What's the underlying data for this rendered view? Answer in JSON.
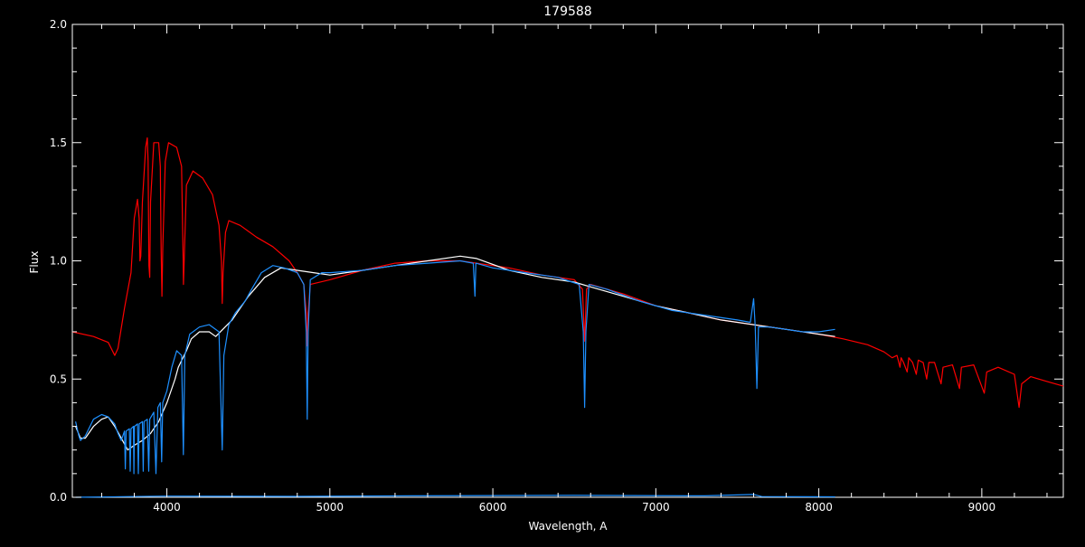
{
  "chart_data": {
    "type": "line",
    "title": "179588",
    "xlabel": "Wavelength, A",
    "ylabel": "Flux",
    "xlim": [
      3420,
      9500
    ],
    "ylim": [
      0.0,
      2.0
    ],
    "x_ticks": [
      {
        "value": 4000,
        "label": "4000"
      },
      {
        "value": 5000,
        "label": "5000"
      },
      {
        "value": 6000,
        "label": "6000"
      },
      {
        "value": 7000,
        "label": "7000"
      },
      {
        "value": 8000,
        "label": "8000"
      },
      {
        "value": 9000,
        "label": "9000"
      }
    ],
    "y_ticks": [
      {
        "value": 0.0,
        "label": "0.0"
      },
      {
        "value": 0.5,
        "label": "0.5"
      },
      {
        "value": 1.0,
        "label": "1.0"
      },
      {
        "value": 1.5,
        "label": "1.5"
      },
      {
        "value": 2.0,
        "label": "2.0"
      }
    ],
    "grid": false,
    "background": "#000000",
    "axis_color": "#ffffff",
    "series": [
      {
        "color": "#ff0000",
        "points": [
          [
            3420,
            0.7
          ],
          [
            3550,
            0.68
          ],
          [
            3640,
            0.655
          ],
          [
            3680,
            0.6
          ],
          [
            3700,
            0.63
          ],
          [
            3740,
            0.8
          ],
          [
            3780,
            0.95
          ],
          [
            3800,
            1.18
          ],
          [
            3820,
            1.26
          ],
          [
            3830,
            1.18
          ],
          [
            3835,
            1.0
          ],
          [
            3840,
            1.02
          ],
          [
            3850,
            1.25
          ],
          [
            3870,
            1.48
          ],
          [
            3880,
            1.52
          ],
          [
            3885,
            1.42
          ],
          [
            3890,
            0.98
          ],
          [
            3895,
            0.93
          ],
          [
            3900,
            1.25
          ],
          [
            3920,
            1.5
          ],
          [
            3950,
            1.5
          ],
          [
            3960,
            1.4
          ],
          [
            3965,
            1.05
          ],
          [
            3970,
            0.85
          ],
          [
            3975,
            1.05
          ],
          [
            3990,
            1.42
          ],
          [
            4010,
            1.5
          ],
          [
            4060,
            1.48
          ],
          [
            4090,
            1.4
          ],
          [
            4100,
            1.0
          ],
          [
            4102,
            0.9
          ],
          [
            4106,
            1.0
          ],
          [
            4120,
            1.32
          ],
          [
            4160,
            1.38
          ],
          [
            4220,
            1.35
          ],
          [
            4280,
            1.28
          ],
          [
            4320,
            1.15
          ],
          [
            4335,
            1.0
          ],
          [
            4340,
            0.82
          ],
          [
            4345,
            0.95
          ],
          [
            4360,
            1.12
          ],
          [
            4380,
            1.17
          ],
          [
            4450,
            1.15
          ],
          [
            4550,
            1.1
          ],
          [
            4650,
            1.06
          ],
          [
            4750,
            1.0
          ],
          [
            4800,
            0.95
          ],
          [
            4840,
            0.9
          ],
          [
            4855,
            0.78
          ],
          [
            4861,
            0.64
          ],
          [
            4867,
            0.78
          ],
          [
            4880,
            0.9
          ],
          [
            5000,
            0.92
          ],
          [
            5200,
            0.96
          ],
          [
            5400,
            0.99
          ],
          [
            5600,
            1.0
          ],
          [
            5800,
            1.0
          ],
          [
            5900,
            0.99
          ],
          [
            6100,
            0.97
          ],
          [
            6300,
            0.94
          ],
          [
            6500,
            0.92
          ],
          [
            6550,
            0.88
          ],
          [
            6563,
            0.66
          ],
          [
            6575,
            0.88
          ],
          [
            6600,
            0.9
          ],
          [
            6800,
            0.86
          ],
          [
            7000,
            0.81
          ],
          [
            7200,
            0.78
          ],
          [
            7400,
            0.75
          ],
          [
            7600,
            0.73
          ],
          [
            7800,
            0.71
          ],
          [
            8000,
            0.69
          ],
          [
            8150,
            0.67
          ],
          [
            8300,
            0.645
          ],
          [
            8400,
            0.615
          ],
          [
            8450,
            0.59
          ],
          [
            8480,
            0.6
          ],
          [
            8498,
            0.55
          ],
          [
            8505,
            0.59
          ],
          [
            8520,
            0.57
          ],
          [
            8542,
            0.53
          ],
          [
            8552,
            0.59
          ],
          [
            8575,
            0.57
          ],
          [
            8598,
            0.52
          ],
          [
            8610,
            0.58
          ],
          [
            8640,
            0.57
          ],
          [
            8662,
            0.5
          ],
          [
            8675,
            0.57
          ],
          [
            8710,
            0.57
          ],
          [
            8750,
            0.48
          ],
          [
            8762,
            0.55
          ],
          [
            8820,
            0.56
          ],
          [
            8863,
            0.46
          ],
          [
            8875,
            0.55
          ],
          [
            8950,
            0.56
          ],
          [
            9015,
            0.44
          ],
          [
            9030,
            0.53
          ],
          [
            9100,
            0.55
          ],
          [
            9200,
            0.52
          ],
          [
            9229,
            0.38
          ],
          [
            9245,
            0.48
          ],
          [
            9300,
            0.51
          ],
          [
            9400,
            0.49
          ],
          [
            9500,
            0.47
          ]
        ]
      },
      {
        "color": "#ffffff",
        "points": [
          [
            3440,
            0.3
          ],
          [
            3470,
            0.25
          ],
          [
            3500,
            0.25
          ],
          [
            3550,
            0.3
          ],
          [
            3600,
            0.33
          ],
          [
            3640,
            0.34
          ],
          [
            3680,
            0.3
          ],
          [
            3720,
            0.25
          ],
          [
            3760,
            0.2
          ],
          [
            3800,
            0.22
          ],
          [
            3850,
            0.24
          ],
          [
            3900,
            0.27
          ],
          [
            3950,
            0.32
          ],
          [
            4000,
            0.4
          ],
          [
            4050,
            0.5
          ],
          [
            4070,
            0.55
          ],
          [
            4120,
            0.62
          ],
          [
            4150,
            0.67
          ],
          [
            4200,
            0.7
          ],
          [
            4260,
            0.7
          ],
          [
            4300,
            0.68
          ],
          [
            4400,
            0.75
          ],
          [
            4500,
            0.85
          ],
          [
            4600,
            0.93
          ],
          [
            4700,
            0.97
          ],
          [
            4800,
            0.96
          ],
          [
            4900,
            0.95
          ],
          [
            5000,
            0.94
          ],
          [
            5200,
            0.96
          ],
          [
            5400,
            0.98
          ],
          [
            5600,
            1.0
          ],
          [
            5800,
            1.02
          ],
          [
            5900,
            1.01
          ],
          [
            6100,
            0.96
          ],
          [
            6300,
            0.93
          ],
          [
            6500,
            0.91
          ],
          [
            6600,
            0.89
          ],
          [
            6800,
            0.85
          ],
          [
            7000,
            0.81
          ],
          [
            7200,
            0.78
          ],
          [
            7400,
            0.75
          ],
          [
            7600,
            0.73
          ],
          [
            7800,
            0.71
          ],
          [
            8000,
            0.69
          ],
          [
            8100,
            0.68
          ]
        ]
      },
      {
        "color": "#1e90ff",
        "points": [
          [
            3440,
            0.32
          ],
          [
            3460,
            0.26
          ],
          [
            3470,
            0.24
          ],
          [
            3500,
            0.26
          ],
          [
            3550,
            0.33
          ],
          [
            3600,
            0.35
          ],
          [
            3640,
            0.34
          ],
          [
            3680,
            0.31
          ],
          [
            3700,
            0.27
          ],
          [
            3720,
            0.24
          ],
          [
            3740,
            0.28
          ],
          [
            3745,
            0.12
          ],
          [
            3750,
            0.28
          ],
          [
            3770,
            0.29
          ],
          [
            3775,
            0.11
          ],
          [
            3780,
            0.29
          ],
          [
            3795,
            0.3
          ],
          [
            3798,
            0.1
          ],
          [
            3801,
            0.3
          ],
          [
            3820,
            0.31
          ],
          [
            3825,
            0.1
          ],
          [
            3830,
            0.31
          ],
          [
            3850,
            0.32
          ],
          [
            3855,
            0.11
          ],
          [
            3860,
            0.32
          ],
          [
            3880,
            0.33
          ],
          [
            3889,
            0.11
          ],
          [
            3895,
            0.33
          ],
          [
            3920,
            0.36
          ],
          [
            3933,
            0.1
          ],
          [
            3945,
            0.38
          ],
          [
            3960,
            0.4
          ],
          [
            3968,
            0.15
          ],
          [
            3975,
            0.4
          ],
          [
            4000,
            0.45
          ],
          [
            4030,
            0.55
          ],
          [
            4060,
            0.62
          ],
          [
            4090,
            0.6
          ],
          [
            4101,
            0.18
          ],
          [
            4110,
            0.6
          ],
          [
            4140,
            0.69
          ],
          [
            4200,
            0.72
          ],
          [
            4260,
            0.73
          ],
          [
            4320,
            0.7
          ],
          [
            4340,
            0.2
          ],
          [
            4350,
            0.6
          ],
          [
            4380,
            0.73
          ],
          [
            4420,
            0.78
          ],
          [
            4480,
            0.83
          ],
          [
            4520,
            0.88
          ],
          [
            4580,
            0.95
          ],
          [
            4650,
            0.98
          ],
          [
            4720,
            0.97
          ],
          [
            4800,
            0.95
          ],
          [
            4840,
            0.9
          ],
          [
            4855,
            0.7
          ],
          [
            4861,
            0.33
          ],
          [
            4867,
            0.7
          ],
          [
            4880,
            0.92
          ],
          [
            4950,
            0.95
          ],
          [
            5000,
            0.95
          ],
          [
            5200,
            0.96
          ],
          [
            5400,
            0.98
          ],
          [
            5600,
            0.99
          ],
          [
            5800,
            1.0
          ],
          [
            5880,
            0.99
          ],
          [
            5890,
            0.85
          ],
          [
            5896,
            0.99
          ],
          [
            6000,
            0.97
          ],
          [
            6200,
            0.95
          ],
          [
            6400,
            0.93
          ],
          [
            6530,
            0.9
          ],
          [
            6555,
            0.7
          ],
          [
            6563,
            0.38
          ],
          [
            6571,
            0.7
          ],
          [
            6590,
            0.9
          ],
          [
            6700,
            0.88
          ],
          [
            6900,
            0.83
          ],
          [
            7100,
            0.79
          ],
          [
            7300,
            0.77
          ],
          [
            7500,
            0.75
          ],
          [
            7580,
            0.74
          ],
          [
            7600,
            0.84
          ],
          [
            7610,
            0.72
          ],
          [
            7620,
            0.46
          ],
          [
            7630,
            0.72
          ],
          [
            7700,
            0.72
          ],
          [
            7900,
            0.7
          ],
          [
            8000,
            0.7
          ],
          [
            8100,
            0.71
          ]
        ]
      },
      {
        "color": "#1e90ff",
        "points": [
          [
            3440,
            0.0
          ],
          [
            4000,
            0.005
          ],
          [
            4800,
            0.004
          ],
          [
            5500,
            0.006
          ],
          [
            6500,
            0.008
          ],
          [
            7300,
            0.006
          ],
          [
            7600,
            0.012
          ],
          [
            7650,
            0.003
          ],
          [
            8100,
            0.002
          ]
        ]
      }
    ]
  }
}
